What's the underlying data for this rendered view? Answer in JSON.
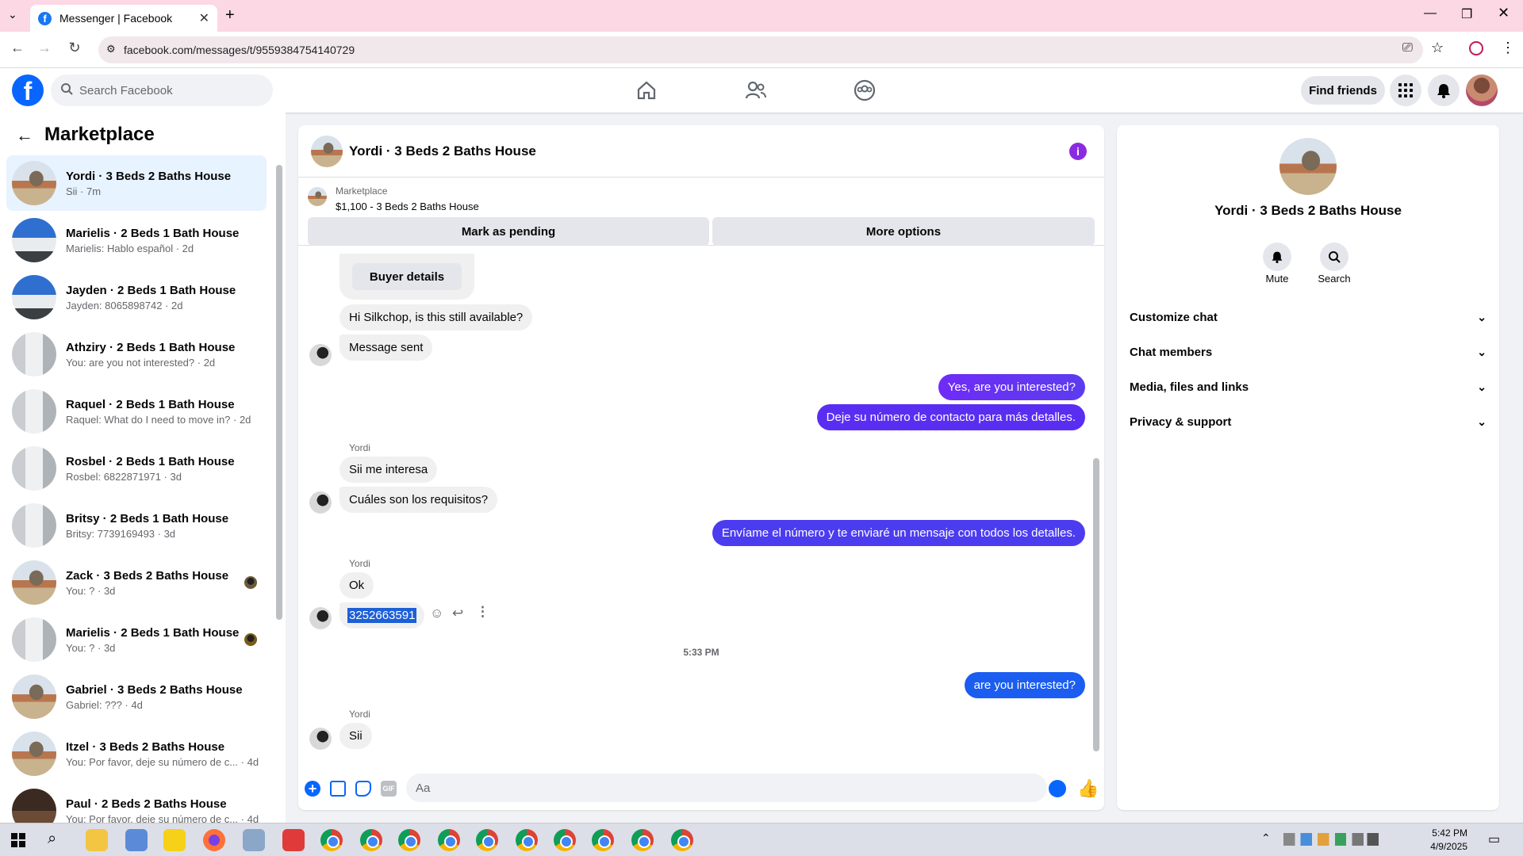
{
  "browser": {
    "tab_title": "Messenger | Facebook",
    "url": "facebook.com/messages/t/9559384754140729"
  },
  "header": {
    "search_placeholder": "Search Facebook",
    "find_friends": "Find friends"
  },
  "sidebar": {
    "title": "Marketplace",
    "chats": [
      {
        "name": "Yordi · 3 Beds 2 Baths House",
        "sub": "Sii · 7m",
        "active": true
      },
      {
        "name": "Marielis · 2 Beds 1 Bath House",
        "sub": "Marielis: Hablo español · 2d"
      },
      {
        "name": "Jayden · 2 Beds 1 Bath House",
        "sub": "Jayden: 8065898742 · 2d"
      },
      {
        "name": "Athziry · 2 Beds 1 Bath House",
        "sub": "You: are you not interested? · 2d"
      },
      {
        "name": "Raquel · 2 Beds 1 Bath House",
        "sub": "Raquel: What do I need to move in? · 2d"
      },
      {
        "name": "Rosbel · 2 Beds 1 Bath House",
        "sub": "Rosbel: 6822871971 · 3d"
      },
      {
        "name": "Britsy · 2 Beds 1 Bath House",
        "sub": "Britsy: 7739169493 · 3d"
      },
      {
        "name": "Zack · 3 Beds 2 Baths House",
        "sub": "You: ? · 3d"
      },
      {
        "name": "Marielis · 2 Beds 1 Bath House",
        "sub": "You: ? · 3d"
      },
      {
        "name": "Gabriel · 3 Beds 2 Baths House",
        "sub": "Gabriel: ??? · 4d"
      },
      {
        "name": "Itzel · 3 Beds 2 Baths House",
        "sub": "You: Por favor, deje su número de c... · 4d"
      },
      {
        "name": "Paul · 2 Beds 2 Baths House",
        "sub": "You: Por favor, deje su número de c... · 4d"
      }
    ]
  },
  "conversation": {
    "title": "Yordi · 3 Beds 2 Baths House",
    "listing_label": "Marketplace",
    "listing_price": "$1,100 - 3 Beds 2 Baths House",
    "mark_pending": "Mark as pending",
    "more_options": "More options",
    "buyer_details": "Buyer details",
    "messages": {
      "m1": "Hi Silkchop, is this still available?",
      "m2": "Message sent",
      "m3": "Yes, are you interested?",
      "m4": "Deje su número de contacto para más detalles.",
      "sender1": "Yordi",
      "m5": "Sii me interesa",
      "m6": "Cuáles son los requisitos?",
      "m7": "Envíame el número y te enviaré un mensaje con todos los detalles.",
      "sender2": "Yordi",
      "m8": "Ok",
      "m9": "3252663591",
      "time": "5:33 PM",
      "m10": "are you interested?",
      "sender3": "Yordi",
      "m11": "Sii"
    },
    "input_placeholder": "Aa"
  },
  "details": {
    "name": "Yordi · 3 Beds 2 Baths House",
    "mute": "Mute",
    "search": "Search",
    "sections": [
      "Customize chat",
      "Chat members",
      "Media, files and links",
      "Privacy & support"
    ]
  },
  "taskbar": {
    "time": "5:42 PM",
    "date": "4/9/2025"
  },
  "colors": {
    "accent": "#0866ff",
    "outgoing_purple": "#6f2cf6",
    "outgoing_blue": "#1a5df0"
  }
}
